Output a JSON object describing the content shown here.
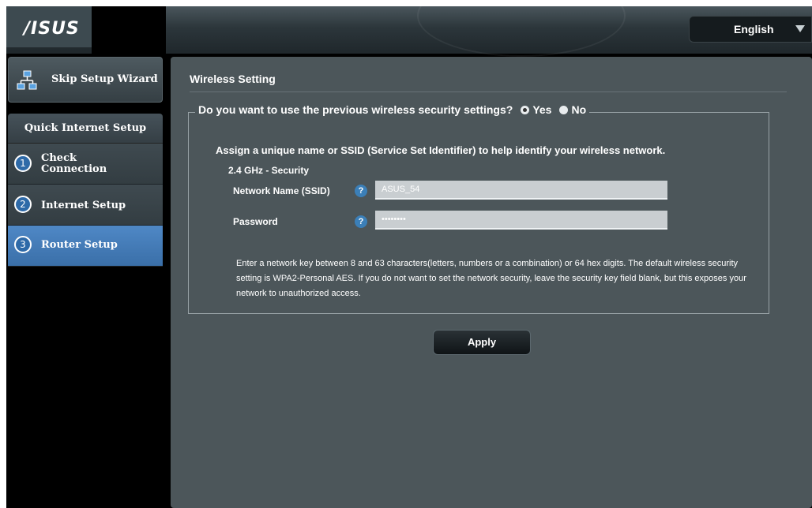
{
  "header": {
    "logo": "/ISUS",
    "language": {
      "label": "English"
    }
  },
  "sidebar": {
    "skip_wizard": "Skip Setup Wizard",
    "section_title": "Quick Internet Setup",
    "steps": [
      {
        "number": "1",
        "label_line1": "Check",
        "label_line2": "Connection"
      },
      {
        "number": "2",
        "label_line1": "Internet Setup",
        "label_line2": ""
      },
      {
        "number": "3",
        "label_line1": "Router Setup",
        "label_line2": "",
        "active": true
      }
    ]
  },
  "main": {
    "title": "Wireless Setting",
    "question": "Do you want to use the previous wireless security settings?",
    "options": {
      "yes": "Yes",
      "no": "No",
      "selected": "Yes"
    },
    "assign_text": "Assign a unique name or SSID (Service Set Identifier) to help identify your wireless network.",
    "band_label": "2.4 GHz - Security",
    "ssid": {
      "label": "Network Name (SSID)",
      "value": "ASUS_54",
      "help": "?"
    },
    "password": {
      "label": "Password",
      "value": "••••••••",
      "help": "?"
    },
    "note": "Enter a network key between 8 and 63 characters(letters, numbers or a combination) or 64 hex digits. The default wireless security setting is WPA2-Personal AES. If you do not want to set the network security, leave the security key field blank, but this exposes your network to unauthorized access.",
    "apply_label": "Apply"
  },
  "colors": {
    "accent_blue": "#3a6fa8",
    "panel_bg": "#4c565a"
  }
}
